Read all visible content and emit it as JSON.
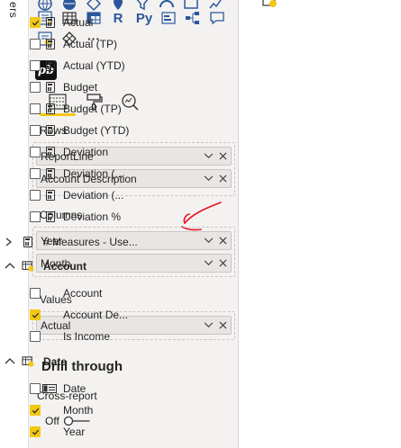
{
  "left_strip": {
    "vertical_text": "ers"
  },
  "viz_pane": {
    "visual_icons": [
      {
        "name": "map-icon"
      },
      {
        "name": "table-icon"
      },
      {
        "name": "matrix-icon"
      },
      {
        "name": "r-visual-icon",
        "text": "R"
      },
      {
        "name": "python-visual-icon",
        "text": "Py"
      },
      {
        "name": "key-influencers-icon"
      },
      {
        "name": "decomposition-tree-icon"
      },
      {
        "name": "qa-icon"
      },
      {
        "name": "smart-narrative-icon"
      },
      {
        "name": "diamond-icon"
      },
      {
        "name": "more-icon",
        "text": "···"
      }
    ],
    "custom_visual_label": "pb",
    "tabs": [
      {
        "name": "fields-tab",
        "active": true
      },
      {
        "name": "format-tab",
        "active": false
      },
      {
        "name": "analytics-tab",
        "active": false
      }
    ],
    "rows": {
      "label": "Rows",
      "fields": [
        "ReportLine",
        "Account Description"
      ]
    },
    "columns": {
      "label": "Columns",
      "fields": [
        "Year",
        "Month"
      ]
    },
    "values": {
      "label": "Values",
      "fields": [
        "Actual"
      ]
    },
    "drill_through": {
      "title": "Drill through",
      "cross_report_label": "Cross-report",
      "toggle_state": "Off"
    }
  },
  "fields_pane": {
    "measures": [
      {
        "label": "Actual",
        "checked": true
      },
      {
        "label": "Actual (TP)",
        "checked": false
      },
      {
        "label": "Actual (YTD)",
        "checked": false
      },
      {
        "label": "Budget",
        "checked": false
      },
      {
        "label": "Budget (TP)",
        "checked": false
      },
      {
        "label": "Budget (YTD)",
        "checked": false
      },
      {
        "label": "Deviation",
        "checked": false
      },
      {
        "label": "Deviation (...",
        "checked": false
      },
      {
        "label": "Deviation (...",
        "checked": false
      },
      {
        "label": "Deviation %",
        "checked": false
      }
    ],
    "measures_table": {
      "label": "# Measures - Use...",
      "expanded": false
    },
    "account_table": {
      "label": "Account",
      "expanded": true,
      "fields": [
        {
          "label": "Account",
          "checked": false
        },
        {
          "label": "Account De...",
          "checked": true
        },
        {
          "label": "Is Income",
          "checked": false
        }
      ]
    },
    "date_table": {
      "label": "Date",
      "expanded": true,
      "fields": [
        {
          "label": "Date",
          "checked": false,
          "hierarchy": true
        },
        {
          "label": "Month",
          "checked": true
        },
        {
          "label": "Year",
          "checked": true
        }
      ]
    }
  },
  "colors": {
    "accent_yellow": "#f2c811",
    "annotation_red": "#e81123",
    "pane_bg": "#f3f2f1"
  }
}
